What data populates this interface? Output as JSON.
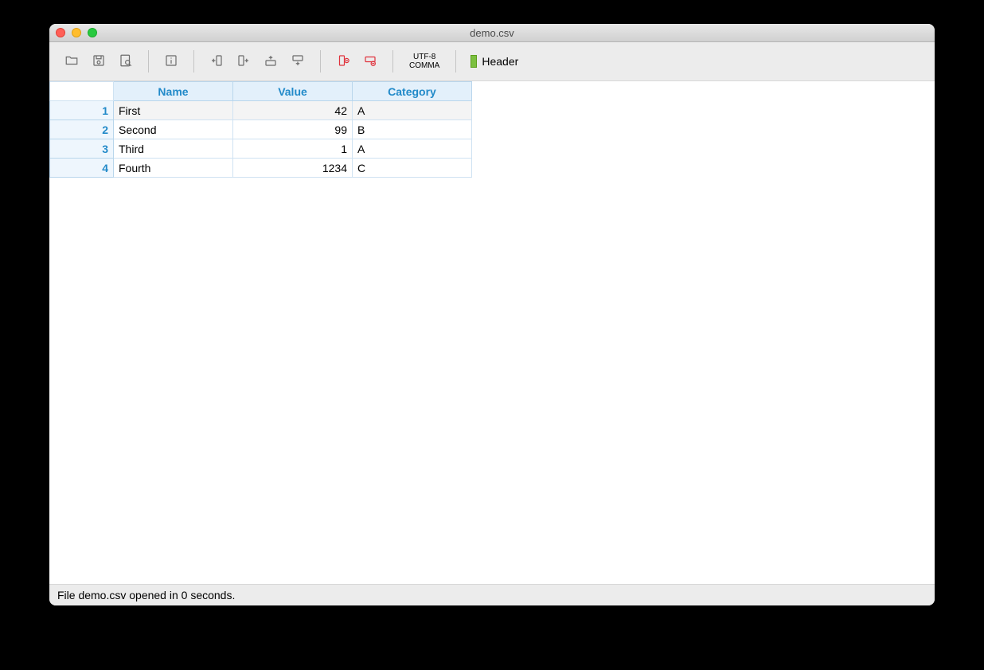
{
  "window": {
    "title": "demo.csv"
  },
  "toolbar": {
    "encoding_line1": "UTF-8",
    "encoding_line2": "COMMA",
    "header_label": "Header"
  },
  "table": {
    "columns": [
      "Name",
      "Value",
      "Category"
    ],
    "rows": [
      {
        "num": "1",
        "name": "First",
        "value": "42",
        "category": "A",
        "selected": true
      },
      {
        "num": "2",
        "name": "Second",
        "value": "99",
        "category": "B",
        "selected": false
      },
      {
        "num": "3",
        "name": "Third",
        "value": "1",
        "category": "A",
        "selected": false
      },
      {
        "num": "4",
        "name": "Fourth",
        "value": "1234",
        "category": "C",
        "selected": false
      }
    ]
  },
  "status": {
    "text": "File demo.csv opened in 0 seconds."
  }
}
